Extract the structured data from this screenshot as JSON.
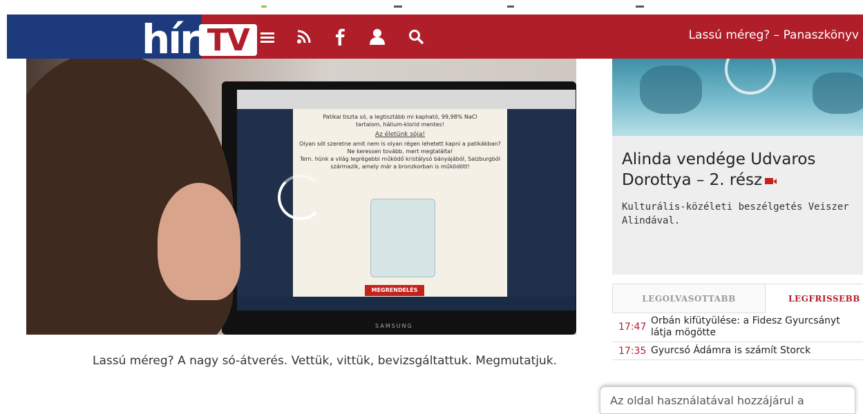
{
  "header": {
    "logo_hir": "hír",
    "logo_tv": "TV",
    "topic_title": "Lassú méreg? – Panaszkönyv",
    "icons": [
      "menu-icon",
      "rss-icon",
      "facebook-icon",
      "user-icon",
      "search-icon"
    ],
    "colors": {
      "blue": "#1d3b7c",
      "red": "#b01e2a"
    }
  },
  "video": {
    "screen_text": {
      "line1": "Patikai tiszta só, a legtisztább mi kapható, 99,98% NaCl",
      "line2": "tartalom, hálium-klorid mentes!",
      "link": "Az életünk sója!",
      "line3": "Olyan sót szeretne amit nem is olyan régen lehetett kapni a patikákban?",
      "line4": "Ne keressen tovább, mert megtalálta!",
      "line5": "Tern. hünk a világ legrégebbi működő kristálysó bányájából, Salzburgból",
      "line6": "származik, amely már a bronzkorban is működött!",
      "order_button": "MEGRENDELÉS"
    },
    "monitor_brand": "SAMSUNG"
  },
  "caption": "Lassú méreg? A nagy só-átverés. Vettük, vittük, bevizsgáltattuk. Megmutatjuk.",
  "sidebar": {
    "feature_title": "Alinda vendége Udvaros Dorottya – 2. rész",
    "feature_desc": "Kulturális-közéleti beszélgetés Veiszer Alindával.",
    "tabs": [
      "LEGOLVASOTTABB",
      "LEGFRISSEBB"
    ],
    "news": [
      {
        "time": "17:47",
        "title": "Orbán kifütyülése: a Fidesz Gyurcsányt látja mögötte"
      },
      {
        "time": "17:35",
        "title": "Gyurcsó Ádámra is számít Storck"
      }
    ]
  },
  "cookie_notice": "Az oldal használatával hozzájárul a"
}
